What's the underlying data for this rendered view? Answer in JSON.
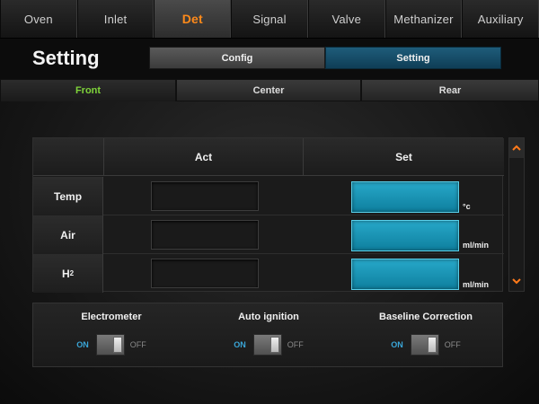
{
  "top_tabs": [
    "Oven",
    "Inlet",
    "Det",
    "Signal",
    "Valve",
    "Methanizer",
    "Auxiliary"
  ],
  "active_tab": "Det",
  "header": {
    "title": "Setting",
    "segments": {
      "config": "Config",
      "setting": "Setting"
    },
    "active_segment": "Setting"
  },
  "sub_tabs": {
    "front": "Front",
    "center": "Center",
    "rear": "Rear",
    "active": "Front"
  },
  "table": {
    "col_act": "Act",
    "col_set": "Set",
    "rows": [
      {
        "label": "Temp",
        "act": "",
        "set": "",
        "unit": "°c"
      },
      {
        "label": "Air",
        "act": "",
        "set": "",
        "unit": "ml/min"
      },
      {
        "label": "H2",
        "label_base": "H",
        "label_sub": "2",
        "act": "",
        "set": "",
        "unit": "ml/min"
      }
    ]
  },
  "scroll": {
    "up_icon": "chevron-up-icon",
    "down_icon": "chevron-down-icon"
  },
  "toggles": [
    {
      "title": "Electrometer",
      "on_label": "ON",
      "off_label": "OFF",
      "state": "off"
    },
    {
      "title": "Auto ignition",
      "on_label": "ON",
      "off_label": "OFF",
      "state": "off"
    },
    {
      "title": "Baseline Correction",
      "on_label": "ON",
      "off_label": "OFF",
      "state": "off"
    }
  ],
  "colors": {
    "active_tab_text": "#ff8a1a",
    "active_subtab_text": "#7fd43a",
    "set_field": "#1b9fc2",
    "on_label": "#3aa6d8"
  }
}
